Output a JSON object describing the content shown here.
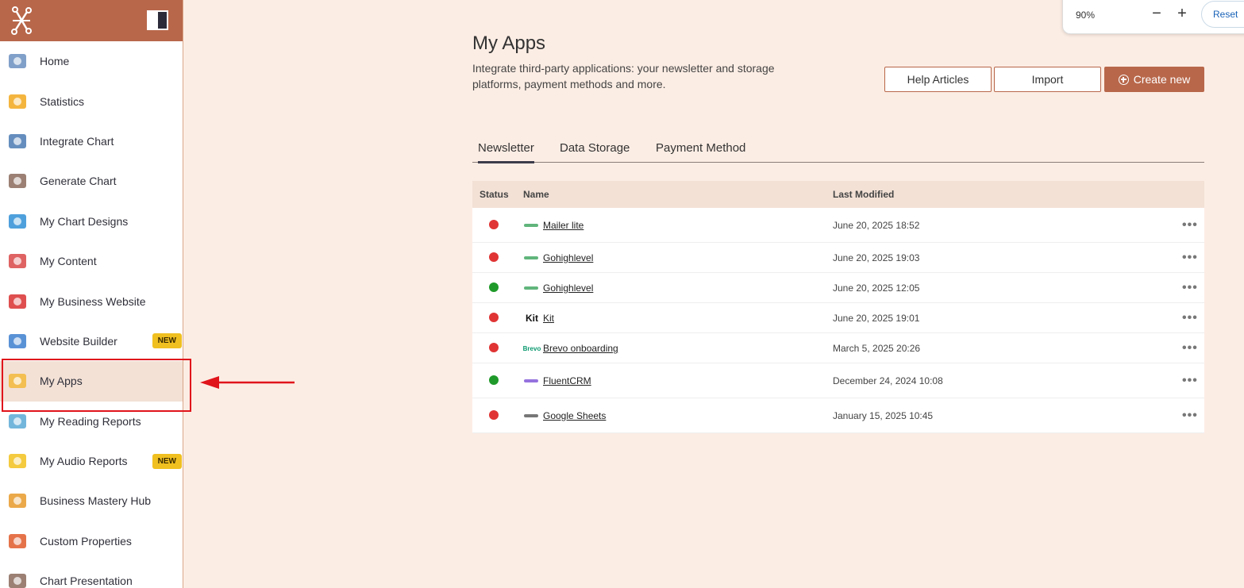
{
  "sidebar": {
    "items": [
      {
        "label": "Home",
        "icon": "home-icon"
      },
      {
        "label": "Statistics",
        "icon": "pie-chart-icon"
      },
      {
        "label": "Integrate Chart",
        "icon": "monitor-chart-icon"
      },
      {
        "label": "Generate Chart",
        "icon": "compass-icon"
      },
      {
        "label": "My Chart Designs",
        "icon": "design-tools-icon"
      },
      {
        "label": "My Content",
        "icon": "chat-bubbles-icon"
      },
      {
        "label": "My Business Website",
        "icon": "website-error-icon"
      },
      {
        "label": "Website Builder",
        "icon": "builder-tools-icon",
        "badge": "NEW"
      },
      {
        "label": "My Apps",
        "icon": "envelope-icon",
        "active": true
      },
      {
        "label": "My Reading Reports",
        "icon": "book-icon"
      },
      {
        "label": "My Audio Reports",
        "icon": "headphones-icon",
        "badge": "NEW"
      },
      {
        "label": "Business Mastery Hub",
        "icon": "medal-icon"
      },
      {
        "label": "Custom Properties",
        "icon": "planet-icon"
      },
      {
        "label": "Chart Presentation",
        "icon": "presentation-icon"
      }
    ]
  },
  "zoom": {
    "level": "90%",
    "minus": "−",
    "plus": "+",
    "reset": "Reset"
  },
  "main": {
    "title": "My Apps",
    "description": "Integrate third-party applications: your newsletter and storage platforms, payment methods and more.",
    "buttons": {
      "help": "Help Articles",
      "import": "Import",
      "create": "Create new"
    },
    "tabs": [
      {
        "label": "Newsletter",
        "active": true
      },
      {
        "label": "Data Storage"
      },
      {
        "label": "Payment Method"
      }
    ],
    "table": {
      "headers": {
        "status": "Status",
        "name": "Name",
        "modified": "Last Modified"
      },
      "rows": [
        {
          "status": "inactive",
          "color": "#e03434",
          "logo": "mailerlite-logo",
          "name": "Mailer lite",
          "modified": "June 20, 2025 18:52",
          "more": "•••"
        },
        {
          "status": "inactive",
          "color": "#e03434",
          "logo": "gohighlevel-logo",
          "name": "Gohighlevel",
          "modified": "June 20, 2025 19:03",
          "more": "•••"
        },
        {
          "status": "active",
          "color": "#1f9a2a",
          "logo": "gohighlevel-logo",
          "name": "Gohighlevel",
          "modified": "June 20, 2025 12:05",
          "more": "•••"
        },
        {
          "status": "inactive",
          "color": "#e03434",
          "logo": "kit-logo",
          "logo_text": "Kit",
          "name": "Kit",
          "modified": "June 20, 2025 19:01",
          "more": "•••"
        },
        {
          "status": "inactive",
          "color": "#e03434",
          "logo": "brevo-logo",
          "logo_text": "Brevo",
          "name": "Brevo onboarding",
          "modified": "March 5, 2025 20:26",
          "more": "•••"
        },
        {
          "status": "active",
          "color": "#1f9a2a",
          "logo": "fluentcrm-logo",
          "name": "FluentCRM",
          "modified": "December 24, 2024 10:08",
          "more": "•••"
        },
        {
          "status": "inactive",
          "color": "#e03434",
          "logo": "zapier-logo",
          "name": "Google Sheets",
          "modified": "January 15, 2025 10:45",
          "more": "•••"
        }
      ]
    }
  },
  "colors": {
    "brand": "#b8674a",
    "background": "#fcede4",
    "annotation": "#e0141b"
  }
}
